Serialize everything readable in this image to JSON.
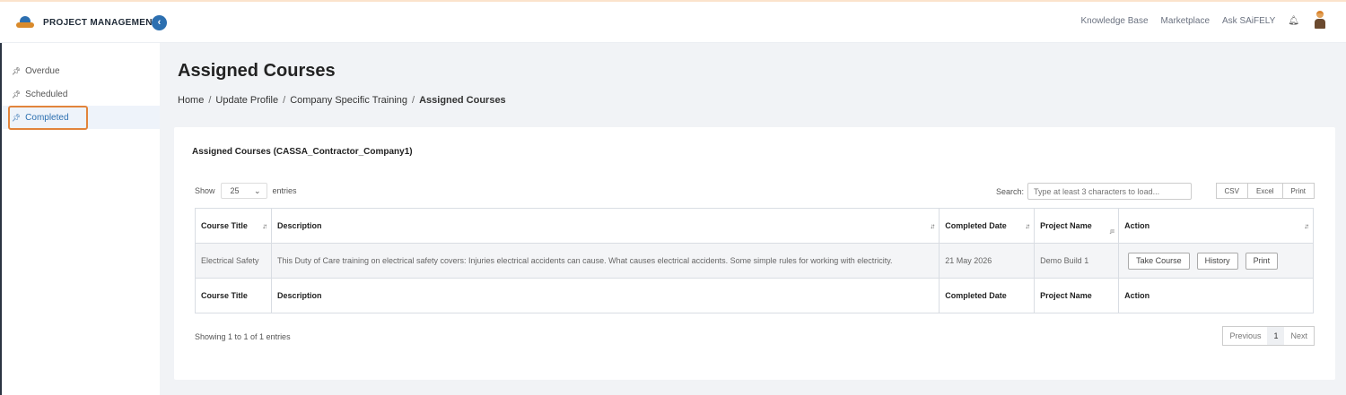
{
  "header": {
    "app_name": "PROJECT MANAGEMENT",
    "collapse_glyph": "‹",
    "nav": [
      "Knowledge Base",
      "Marketplace",
      "Ask SAiFELY"
    ],
    "bell_icon": "bell-icon",
    "avatar_icon": "user-avatar",
    "accent_color": "#2c6fb0"
  },
  "sidebar": {
    "items": [
      {
        "label": "Overdue",
        "icon": "pin-icon"
      },
      {
        "label": "Scheduled",
        "icon": "pin-icon"
      },
      {
        "label": "Completed",
        "icon": "pin-icon",
        "active": true
      }
    ],
    "highlight_color": "#e2843b"
  },
  "page": {
    "title": "Assigned Courses",
    "breadcrumb": [
      "Home",
      "Update Profile",
      "Company Specific Training",
      "Assigned Courses"
    ]
  },
  "card": {
    "title": "Assigned Courses (CASSA_Contractor_Company1)",
    "show_label": "Show",
    "page_length": "25",
    "entries_label": "entries",
    "search_label": "Search:",
    "search_placeholder": "Type at least 3 characters to load...",
    "export_buttons": [
      "CSV",
      "Excel",
      "Print"
    ],
    "columns": [
      "Course Title",
      "Description",
      "Completed Date",
      "Project Name",
      "Action"
    ],
    "rows": [
      {
        "course_title": "Electrical Safety",
        "description": "This Duty of Care training on electrical safety covers: Injuries electrical accidents can cause. What causes electrical accidents. Some simple rules for working with electricity.",
        "completed_date": "21 May 2026",
        "project_name": "Demo Build 1",
        "actions": [
          "Take Course",
          "History",
          "Print"
        ]
      }
    ],
    "info": "Showing 1 to 1 of 1 entries",
    "pagination": {
      "previous": "Previous",
      "current": "1",
      "next": "Next"
    }
  }
}
